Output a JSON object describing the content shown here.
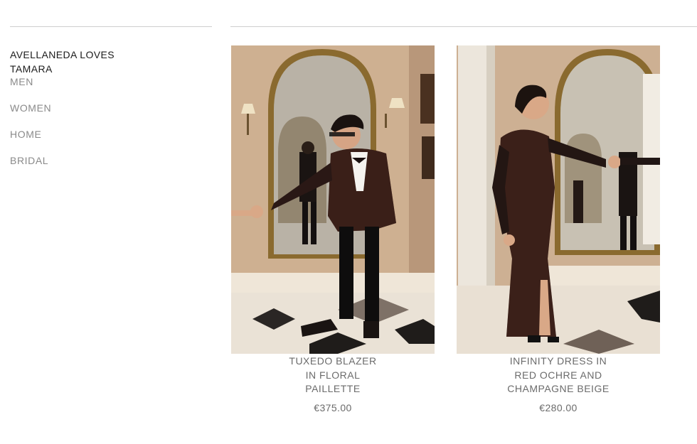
{
  "sidebar": {
    "brand": "AVELLANEDA LOVES TAMARA",
    "nav": [
      {
        "label": "MEN"
      },
      {
        "label": "WOMEN"
      },
      {
        "label": "HOME"
      },
      {
        "label": "BRIDAL"
      }
    ]
  },
  "products": [
    {
      "name": "TUXEDO BLAZER IN FLORAL PAILLETTE",
      "price": "€375.00"
    },
    {
      "name": "INFINITY DRESS IN RED OCHRE AND CHAMPAGNE BEIGE",
      "price": "€280.00"
    }
  ],
  "colors": {
    "text_dark": "#1b1b1b",
    "text_muted": "#8a8a8a",
    "price_text": "#6b6b6b",
    "rule": "#cfcfcf",
    "photo_wall": "#c9ab8e",
    "mirror_frame": "#9c7a3c"
  }
}
